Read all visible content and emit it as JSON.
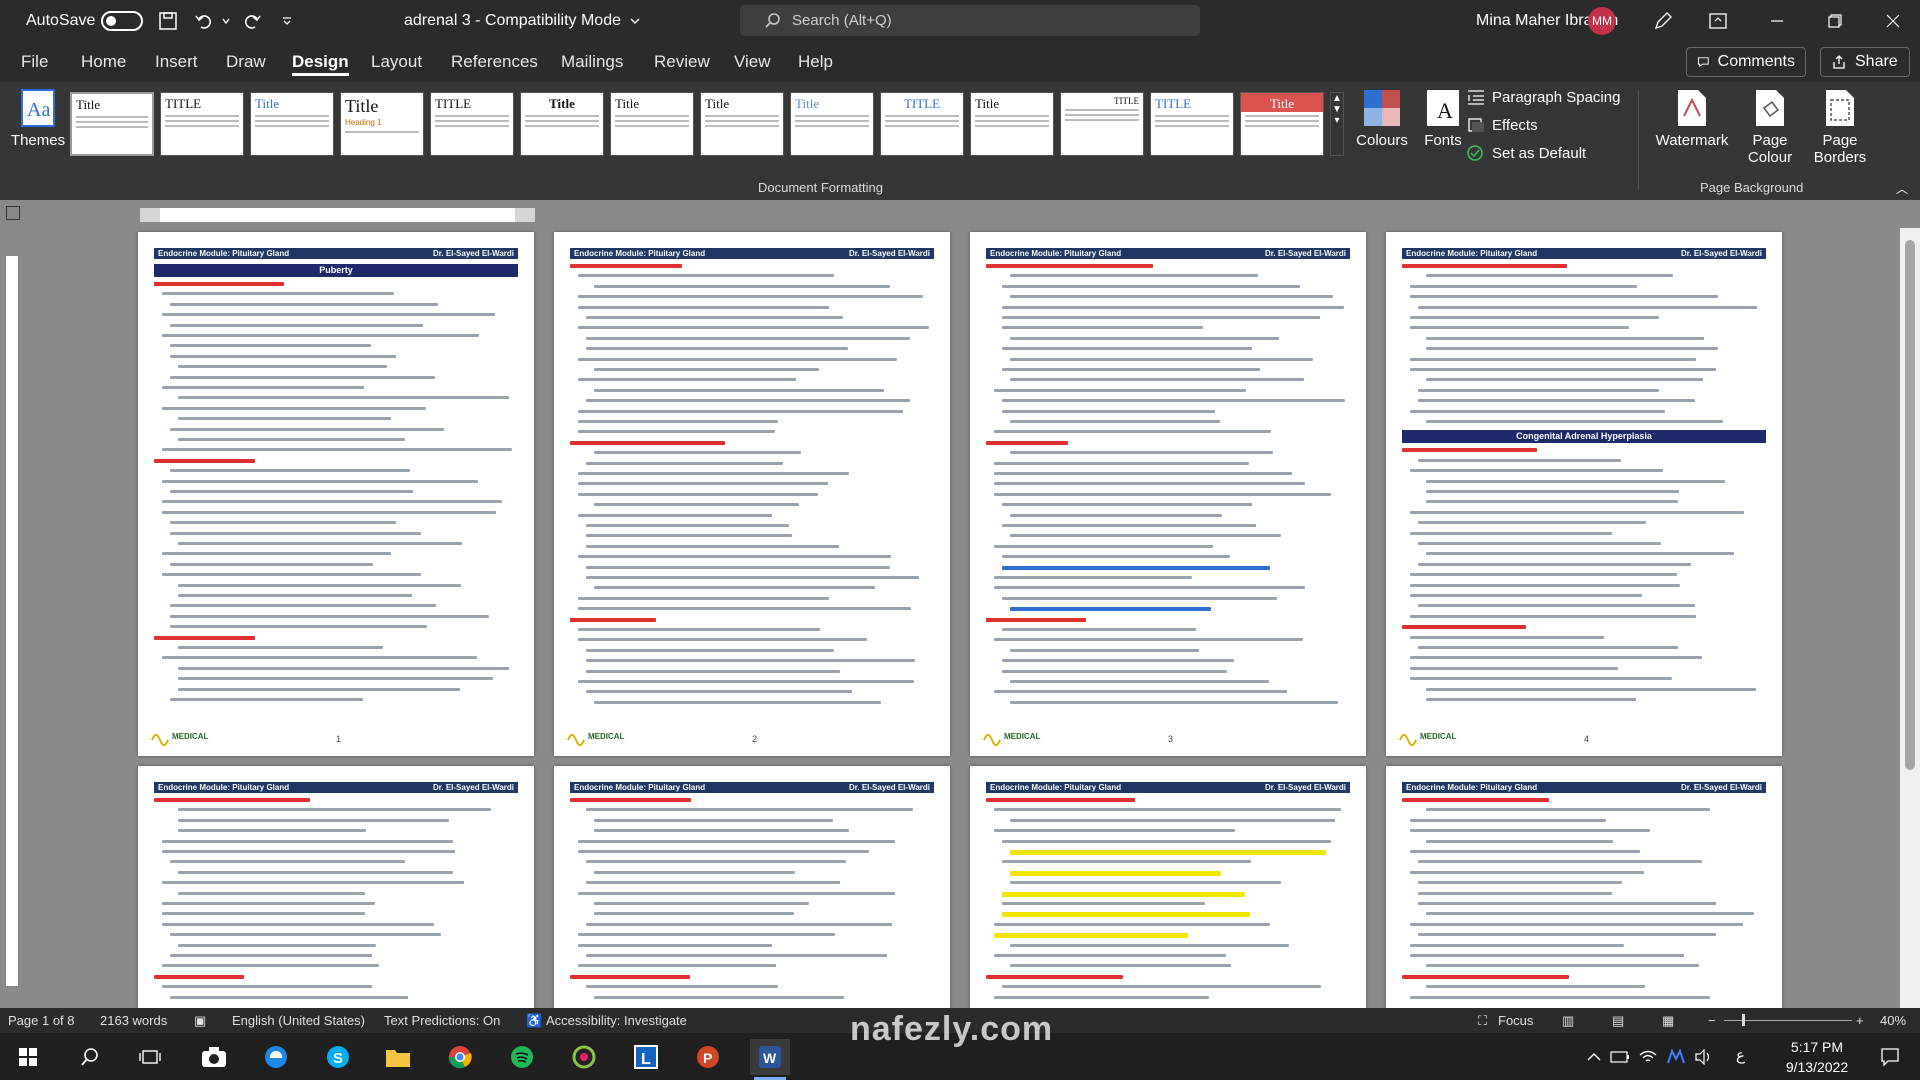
{
  "titlebar": {
    "autosave_label": "AutoSave",
    "autosave_state": "Off",
    "document_title": "adrenal 3  -  Compatibility Mode",
    "search_placeholder": "Search (Alt+Q)",
    "user_name": "Mina Maher Ibrahim",
    "user_initials": "MM"
  },
  "menu": {
    "tabs": [
      "File",
      "Home",
      "Insert",
      "Draw",
      "Design",
      "Layout",
      "References",
      "Mailings",
      "Review",
      "View",
      "Help"
    ],
    "active_tab": "Design",
    "comments_label": "Comments",
    "share_label": "Share"
  },
  "ribbon": {
    "themes_label": "Themes",
    "gallery_titles": [
      "Title",
      "TITLE",
      "Title",
      "Title",
      "TITLE",
      "Title",
      "Title",
      "Title",
      "Title",
      "TITLE",
      "Title",
      "TITLE",
      "TITLE",
      "Title"
    ],
    "colours_label": "Colours",
    "fonts_label": "Fonts",
    "paragraph_spacing_label": "Paragraph Spacing",
    "effects_label": "Effects",
    "set_default_label": "Set as Default",
    "document_formatting_label": "Document Formatting",
    "watermark_label": "Watermark",
    "page_colour_label": "Page Colour",
    "page_borders_label": "Page Borders",
    "page_background_label": "Page Background"
  },
  "pages": {
    "header_left": "Endocrine Module: Pituitary Gland",
    "header_right": "Dr. El-Sayed El-Wardi",
    "footer_logo": "MEDICAL",
    "page1_band": "Puberty",
    "page4_band": "Congenital Adrenal Hyperplasia",
    "numbers": [
      "1",
      "2",
      "3",
      "4"
    ]
  },
  "statusbar": {
    "page": "Page 1 of 8",
    "words": "2163 words",
    "language": "English (United States)",
    "text_predictions": "Text Predictions: On",
    "accessibility": "Accessibility: Investigate",
    "focus": "Focus",
    "zoom": "40%"
  },
  "taskbar": {
    "time": "5:17 PM",
    "date": "9/13/2022",
    "lang": "ع"
  },
  "watermark_text": "nafezly.com",
  "colors": {
    "title_bar": "#2b2b2b",
    "ribbon": "#363636",
    "canvas": "#8a8a8a",
    "header_band": "#1f3864",
    "heading_red": "#e03030",
    "highlight": "#f2e600",
    "avatar": "#c4314b"
  }
}
